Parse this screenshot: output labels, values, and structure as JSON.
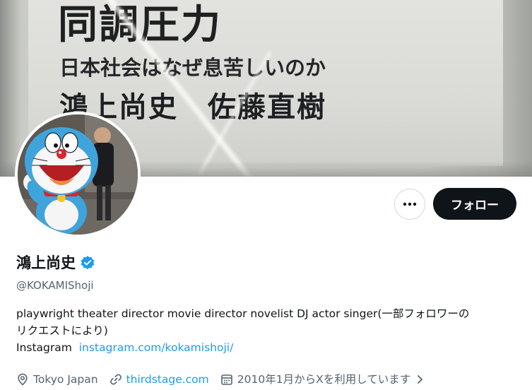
{
  "banner": {
    "title": "同調圧力",
    "subtitle": "日本社会はなぜ息苦しいのか",
    "authors": "鴻上尚史　佐藤直樹"
  },
  "profile": {
    "name": "鴻上尚史",
    "handle": "@KOKAMIShoji",
    "verified_icon": "verified-badge-icon",
    "bio_line1": "playwright theater director movie director novelist DJ actor singer(一部フォロワーの",
    "bio_line2": "リクエストにより)",
    "instagram_label": "Instagram",
    "instagram_link": "instagram.com/kokamishoji/",
    "location": "Tokyo Japan",
    "website": "thirdstage.com",
    "joined": "2010年1月からXを利用しています"
  },
  "actions": {
    "more_label": "•••",
    "follow_label": "フォロー"
  },
  "colors": {
    "accent": "#1d9bf0",
    "follow_bg": "#0f1419",
    "secondary_text": "#536471"
  }
}
